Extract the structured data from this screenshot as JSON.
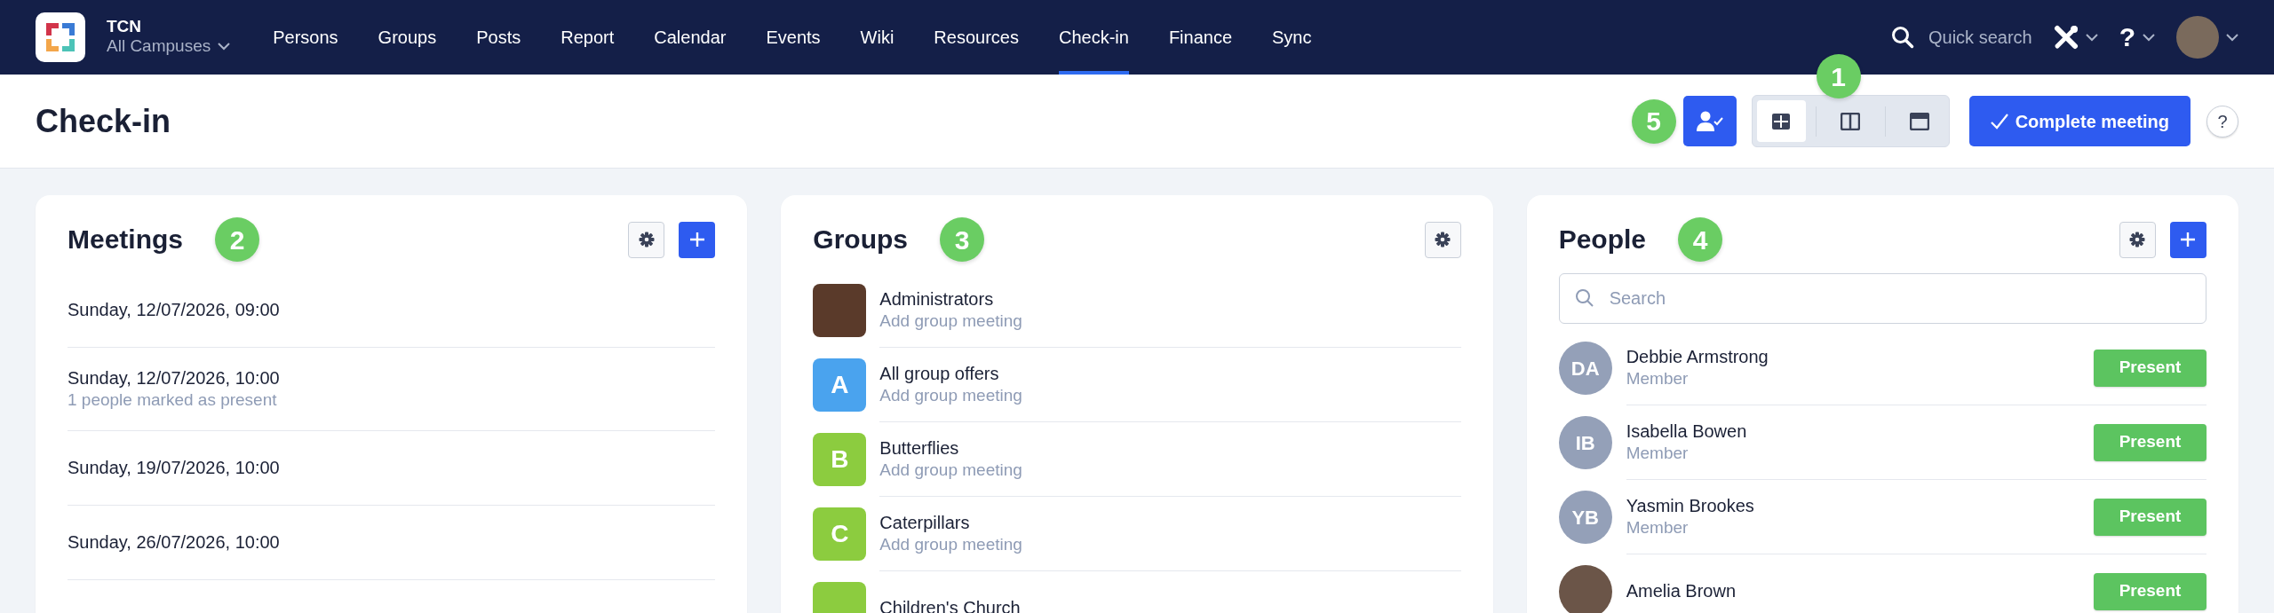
{
  "navbar": {
    "brand": "TCN",
    "campus": "All Campuses",
    "items": [
      {
        "label": "Persons",
        "selected": false
      },
      {
        "label": "Groups",
        "selected": false
      },
      {
        "label": "Posts",
        "selected": false
      },
      {
        "label": "Report",
        "selected": false
      },
      {
        "label": "Calendar",
        "selected": false
      },
      {
        "label": "Events",
        "selected": false
      },
      {
        "label": "Wiki",
        "selected": false
      },
      {
        "label": "Resources",
        "selected": false
      },
      {
        "label": "Check-in",
        "selected": true
      },
      {
        "label": "Finance",
        "selected": false
      },
      {
        "label": "Sync",
        "selected": false
      }
    ],
    "quick_search": "Quick search",
    "help": "?"
  },
  "header": {
    "title": "Check-in",
    "checkin_marker": "5",
    "view_marker": "1",
    "view_modes": [
      {
        "kind": "grid",
        "selected": true
      },
      {
        "kind": "columns",
        "selected": false
      },
      {
        "kind": "single",
        "selected": false
      }
    ],
    "complete_button": "Complete meeting",
    "help": "?"
  },
  "meetings": {
    "title": "Meetings",
    "marker": "2",
    "items": [
      {
        "date": "Sunday, 12/07/2026, 09:00"
      },
      {
        "date": "Sunday, 12/07/2026, 10:00",
        "note": "1 people marked as present"
      },
      {
        "date": "Sunday, 19/07/2026, 10:00"
      },
      {
        "date": "Sunday, 26/07/2026, 10:00"
      }
    ]
  },
  "groups": {
    "title": "Groups",
    "marker": "3",
    "items": [
      {
        "kind": "photo",
        "name": "Administrators",
        "action": "Add group meeting"
      },
      {
        "kind": "letter",
        "letter": "A",
        "color": "#4aa3ee",
        "name": "All group offers",
        "action": "Add group meeting"
      },
      {
        "kind": "letter",
        "letter": "B",
        "color": "#8ccc3f",
        "name": "Butterflies",
        "action": "Add group meeting"
      },
      {
        "kind": "letter",
        "letter": "C",
        "color": "#8ccc3f",
        "name": "Caterpillars",
        "action": "Add group meeting"
      },
      {
        "kind": "letter",
        "color": "#8ccc3f",
        "name": "Children's Church"
      }
    ]
  },
  "people": {
    "title": "People",
    "marker": "4",
    "search_placeholder": "Search",
    "items": [
      {
        "kind": "initials",
        "initials": "DA",
        "name": "Debbie Armstrong",
        "role": "Member",
        "button": "Present"
      },
      {
        "kind": "initials",
        "initials": "IB",
        "name": "Isabella Bowen",
        "role": "Member",
        "button": "Present"
      },
      {
        "kind": "initials",
        "initials": "YB",
        "name": "Yasmin Brookes",
        "role": "Member",
        "button": "Present"
      },
      {
        "kind": "photo",
        "name": "Amelia Brown",
        "button": "Present"
      }
    ]
  }
}
